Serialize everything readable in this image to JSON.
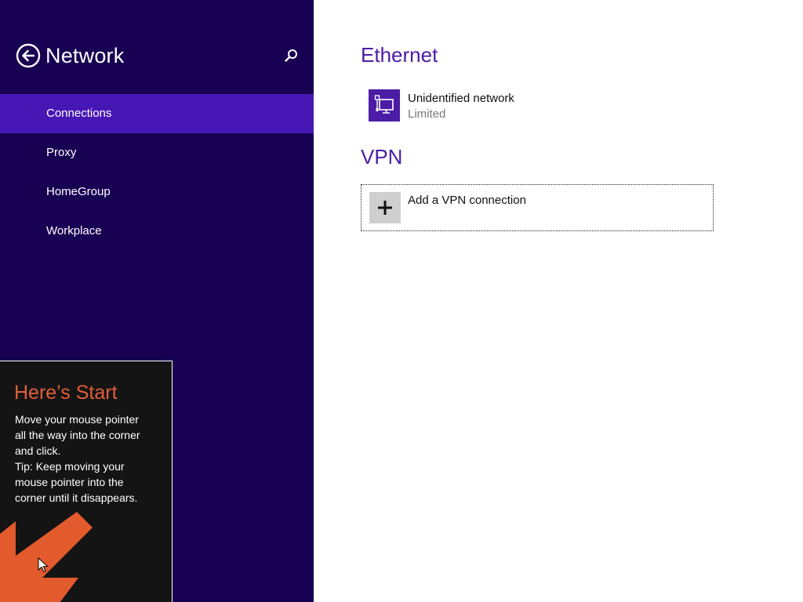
{
  "sidebar": {
    "title": "Network",
    "back_icon": "back-arrow-icon",
    "search_icon": "search-icon",
    "accent_color": "#4617b4",
    "background_color": "#180052",
    "items": [
      {
        "label": "Connections",
        "selected": true
      },
      {
        "label": "Proxy",
        "selected": false
      },
      {
        "label": "HomeGroup",
        "selected": false
      },
      {
        "label": "Workplace",
        "selected": false
      }
    ]
  },
  "tip": {
    "title": "Here’s Start",
    "lines": [
      "Move your mouse pointer",
      "all the way into the corner",
      "and click.",
      "Tip: Keep moving your",
      "mouse pointer into the",
      "corner until it disappears."
    ],
    "title_color": "#e35f3a",
    "arrow_color": "#e35a2c"
  },
  "ethernet": {
    "heading": "Ethernet",
    "network_name": "Unidentified network",
    "network_status": "Limited",
    "icon": "ethernet-network-icon"
  },
  "vpn": {
    "heading": "VPN",
    "add_label": "Add a VPN connection",
    "icon": "plus-icon"
  }
}
